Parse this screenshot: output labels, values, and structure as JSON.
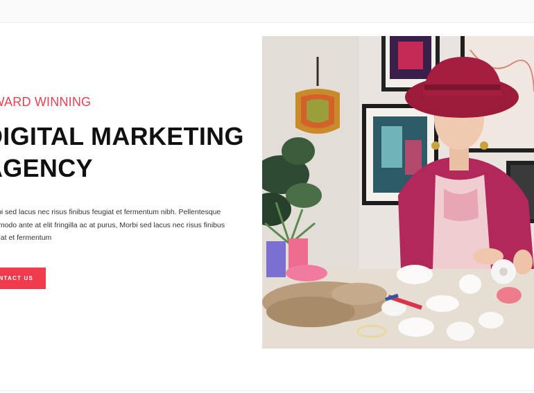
{
  "hero": {
    "eyebrow": "AWARD WINNING",
    "headline_line1": "DIGITAL MARKETING",
    "headline_line2": "AGENCY",
    "paragraph_lines": [
      "Morbi sed lacus nec risus finibus feugiat et fermentum nibh. Pellentesque",
      "commodo ante at elit fringilla ac at purus, Morbi sed lacus nec risus finibus",
      "feugiat et fermentum"
    ],
    "cta_label": "CONTACT US"
  },
  "colors": {
    "accent": "#ef3b4c",
    "headline": "#111111",
    "body_text": "#333333"
  }
}
